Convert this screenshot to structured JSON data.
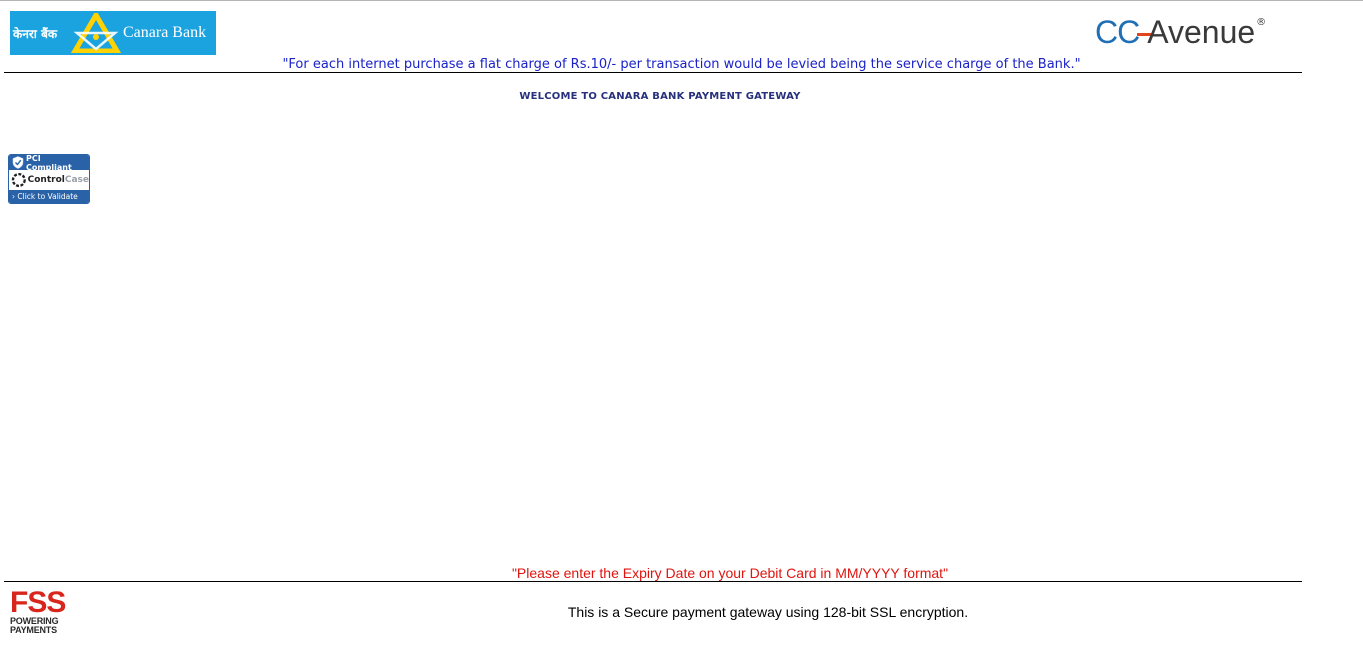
{
  "header": {
    "bank_logo": {
      "hindi_text": "केनरा बैंक",
      "name_text": "Canara Bank",
      "bg_color": "#1ba3e0"
    },
    "gateway_logo": {
      "part1": "CC",
      "part2": "Avenue",
      "reg_mark": "®",
      "color_primary": "#1f6fb5",
      "color_accent": "#e0461d"
    },
    "service_charge_notice": "\"For each internet purchase a flat charge of Rs.10/- per transaction would be levied being the service charge of the Bank.\""
  },
  "main": {
    "welcome_title": "WELCOME TO CANARA BANK PAYMENT GATEWAY",
    "pci_badge": {
      "top_label": "PCI Compliant",
      "control_text": "Control",
      "case_text": "Case",
      "bottom_label": "› Click to Validate",
      "icon": "shield-icon"
    },
    "error_message": "\"Please enter the Expiry Date on your Debit Card in MM/YYYY format\""
  },
  "footer": {
    "fss_logo": {
      "letters": "FSS",
      "tag_line1": "POWERING",
      "tag_line2": "PAYMENTS",
      "color": "#d8261c"
    },
    "secure_message": "This is a Secure payment gateway using 128-bit SSL encryption."
  },
  "colors": {
    "notice_blue": "#1a22c8",
    "welcome_navy": "#27307c",
    "error_red": "#e0140f"
  }
}
